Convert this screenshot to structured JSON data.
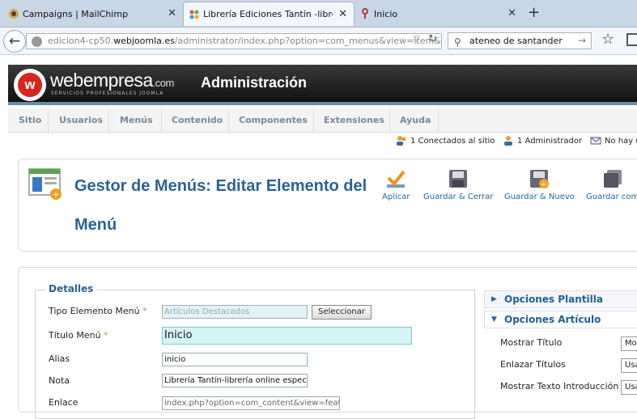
{
  "browser": {
    "tabs": [
      {
        "title": "Campaigns | MailChimp"
      },
      {
        "title": "Librería Ediciones Tantín -libre..."
      },
      {
        "title": "Inicio"
      }
    ],
    "url_prefix": "edicion4-cp50.",
    "url_domain": "webjoomla.es",
    "url_rest": "/administrator/index.php?option=com_menus&view=item&layout",
    "search_value": "ateneo de santander"
  },
  "header": {
    "logo_name": "webempresa",
    "logo_tld": ".com",
    "logo_tagline": "SERVICIOS PROFESIONALES JOOMLA",
    "title": "Administración"
  },
  "menu": [
    "Sitio",
    "Usuarios",
    "Menús",
    "Contenido",
    "Componentes",
    "Extensiones",
    "Ayuda"
  ],
  "status": {
    "online": "1 Conectados al sitio",
    "admins": "1 Administrador",
    "messages": "No hay m"
  },
  "toolbar": {
    "page_title": "Gestor de Menús: Editar Elemento del Menú",
    "apply": "Aplicar",
    "save_close": "Guardar & Cerrar",
    "save_new": "Guardar & Nuevo",
    "save_copy": "Guardar com"
  },
  "details": {
    "legend": "Detalles",
    "type_label": "Tipo Elemento Menú",
    "type_value": "Artículos Destacados",
    "select_btn": "Seleccionar",
    "title_label": "Título Menú",
    "title_value": "Inicio",
    "alias_label": "Alias",
    "alias_value": "inicio",
    "note_label": "Nota",
    "note_value": "Librería Tantín-librería online especializ",
    "link_label": "Enlace",
    "link_value": "index.php?option=com_content&view=featu"
  },
  "options": {
    "template_title": "Opciones Plantilla",
    "article_title": "Opciones Artículo",
    "show_title_label": "Mostrar Título",
    "show_title_value": "Mo",
    "link_titles_label": "Enlazar Títulos",
    "link_titles_value": "Usa",
    "show_intro_label": "Mostrar Texto Introducción",
    "show_intro_value": "Usa"
  },
  "colors": {
    "accent": "#2a6496",
    "brand_red": "#d8261c",
    "header_bg": "#1a1a1a"
  }
}
